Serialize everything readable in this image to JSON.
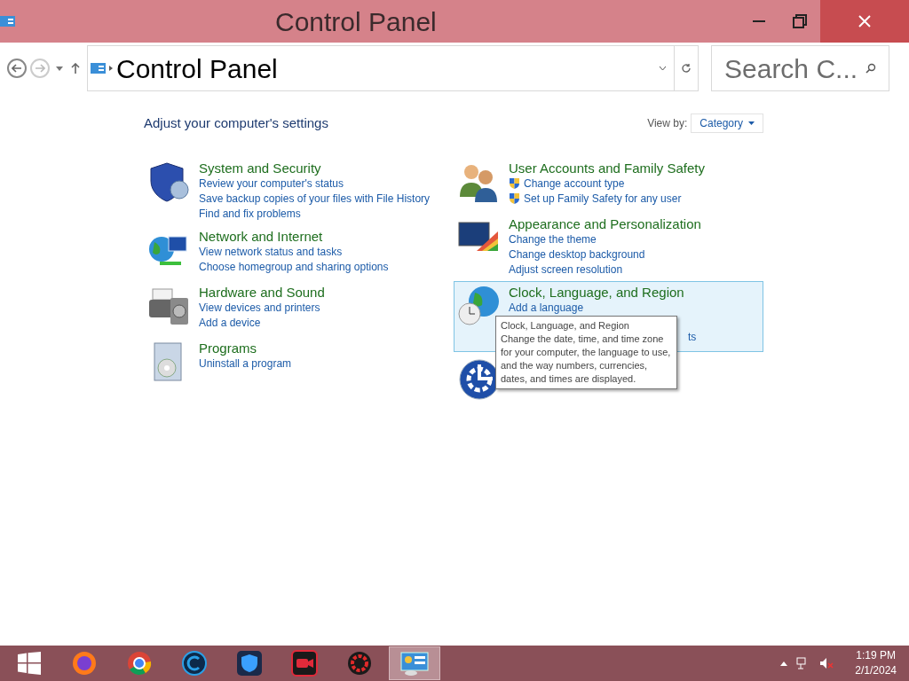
{
  "window": {
    "title": "Control Panel"
  },
  "address_bar": {
    "path": "Control Panel",
    "search_placeholder": "Search C..."
  },
  "content": {
    "heading": "Adjust your computer's settings",
    "view_by_label": "View by:",
    "view_by_value": "Category"
  },
  "left_categories": [
    {
      "kind": "security",
      "title": "System and Security",
      "hovered": false,
      "links": [
        {
          "text": "Review your computer's status",
          "shield": false
        },
        {
          "text": "Save backup copies of your files with File History",
          "shield": false
        },
        {
          "text": "Find and fix problems",
          "shield": false
        }
      ]
    },
    {
      "kind": "network",
      "title": "Network and Internet",
      "hovered": false,
      "links": [
        {
          "text": "View network status and tasks",
          "shield": false
        },
        {
          "text": "Choose homegroup and sharing options",
          "shield": false
        }
      ]
    },
    {
      "kind": "hardware",
      "title": "Hardware and Sound",
      "hovered": false,
      "links": [
        {
          "text": "View devices and printers",
          "shield": false
        },
        {
          "text": "Add a device",
          "shield": false
        }
      ]
    },
    {
      "kind": "programs",
      "title": "Programs",
      "hovered": false,
      "links": [
        {
          "text": "Uninstall a program",
          "shield": false
        }
      ]
    }
  ],
  "right_categories": [
    {
      "kind": "users",
      "title": "User Accounts and Family Safety",
      "hovered": false,
      "links": [
        {
          "text": "Change account type",
          "shield": true
        },
        {
          "text": "Set up Family Safety for any user",
          "shield": true
        }
      ]
    },
    {
      "kind": "appearance",
      "title": "Appearance and Personalization",
      "hovered": false,
      "links": [
        {
          "text": "Change the theme",
          "shield": false
        },
        {
          "text": "Change desktop background",
          "shield": false
        },
        {
          "text": "Adjust screen resolution",
          "shield": false
        }
      ]
    },
    {
      "kind": "clock",
      "title": "Clock, Language, and Region",
      "hovered": true,
      "links": [
        {
          "text": "Add a language",
          "shield": false
        },
        {
          "text": "ts",
          "shield": false,
          "fragment": true
        }
      ]
    },
    {
      "kind": "ease"
    }
  ],
  "tooltip": {
    "title": "Clock, Language, and Region",
    "text": "Change the date, time, and time zone for your computer, the language to use, and the way numbers, currencies, dates, and times are displayed."
  },
  "taskbar": {
    "apps": [
      {
        "kind": "start",
        "selected": false
      },
      {
        "kind": "firefox",
        "selected": false
      },
      {
        "kind": "chrome",
        "selected": false
      },
      {
        "kind": "ccleaner",
        "selected": false
      },
      {
        "kind": "vpn",
        "selected": false
      },
      {
        "kind": "recorder",
        "selected": false
      },
      {
        "kind": "booster",
        "selected": false
      },
      {
        "kind": "control-panel",
        "selected": true
      }
    ],
    "time": "1:19 PM",
    "date": "2/1/2024"
  }
}
